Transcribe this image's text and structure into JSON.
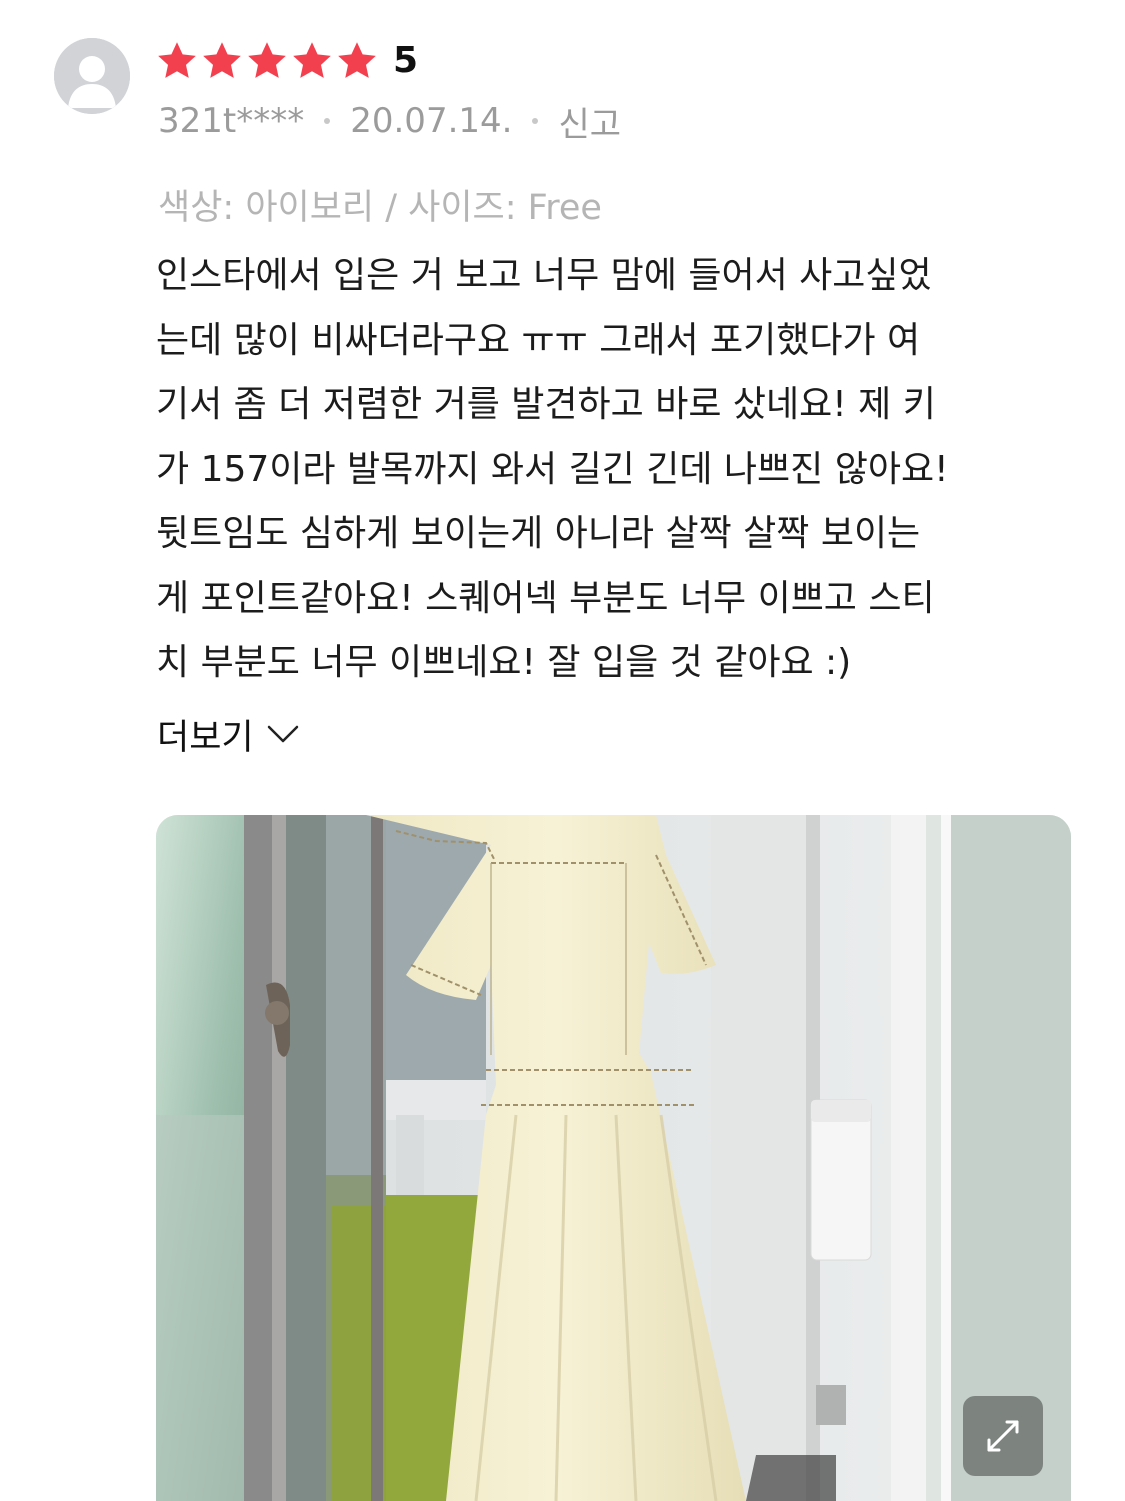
{
  "review": {
    "rating": "5",
    "rating_value": 5,
    "rating_max": 5,
    "author": "321t****",
    "date": "20.07.14.",
    "report_label": "신고",
    "option_text": "색상: 아이보리 / 사이즈: Free",
    "body_lines": [
      "인스타에서 입은 거 보고 너무 맘에 들어서 사고싶었",
      "는데 많이 비싸더라구요 ㅠㅠ 그래서 포기했다가 여",
      "기서 좀 더 저렴한 거를 발견하고 바로 샀네요! 제 키",
      "가 157이라 발목까지 와서 길긴 긴데 나쁘진 않아요!",
      "뒷트임도 심하게 보이는게 아니라 살짝 살짝 보이는",
      "게 포인트같아요! 스퀘어넥 부분도 너무 이쁘고  스티",
      "치 부분도 너무 이쁘네요! 잘 입을 것 같아요 :)"
    ],
    "more_label": "더보기"
  },
  "icons": {
    "avatar": "user-silhouette-icon",
    "star": "star-filled-icon",
    "more": "chevron-down-icon",
    "expand": "expand-diagonal-icon"
  },
  "colors": {
    "star": "#f3404f",
    "meta_text": "#9b9b9b",
    "option_text": "#b5b5b5",
    "body_text": "#1c1c1c",
    "dress": "#f4efcf"
  }
}
